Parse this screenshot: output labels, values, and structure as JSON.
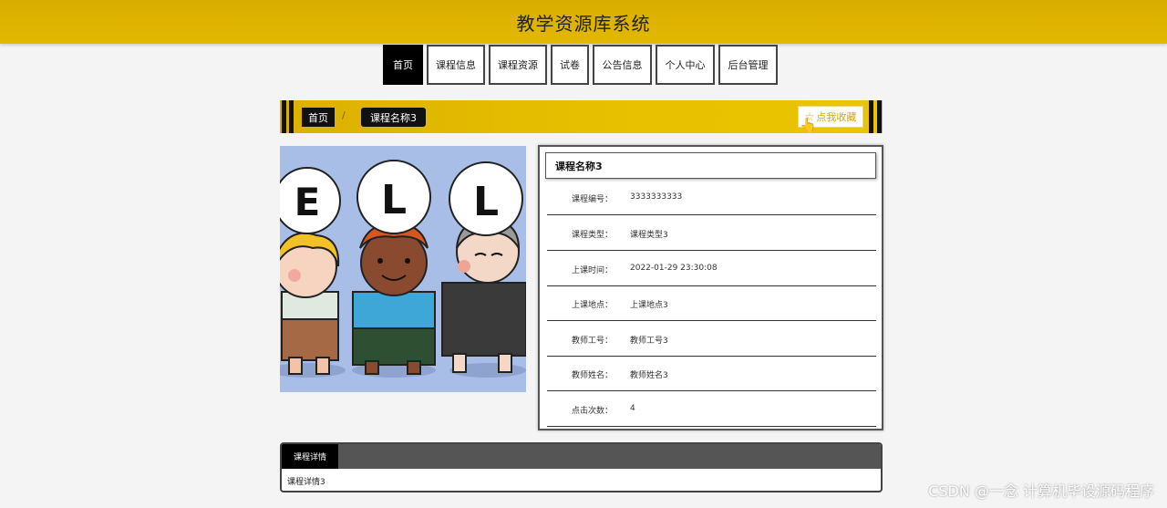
{
  "header": {
    "title": "教学资源库系统"
  },
  "nav": {
    "items": [
      {
        "label": "首页"
      },
      {
        "label": "课程信息"
      },
      {
        "label": "课程资源"
      },
      {
        "label": "试卷"
      },
      {
        "label": "公告信息"
      },
      {
        "label": "个人中心"
      },
      {
        "label": "后台管理"
      }
    ],
    "active_index": 0
  },
  "breadcrumb": {
    "home": "首页",
    "separator": "/",
    "current": "课程名称3",
    "favorite_label": "点我收藏"
  },
  "course": {
    "name": "课程名称3",
    "fields": [
      {
        "label": "课程编号：",
        "value": "3333333333"
      },
      {
        "label": "课程类型：",
        "value": "课程类型3"
      },
      {
        "label": "上课时间：",
        "value": "2022-01-29 23:30:08"
      },
      {
        "label": "上课地点：",
        "value": "上课地点3"
      },
      {
        "label": "教师工号：",
        "value": "教师工号3"
      },
      {
        "label": "教师姓名：",
        "value": "教师姓名3"
      },
      {
        "label": "点击次数：",
        "value": "4"
      }
    ]
  },
  "detail": {
    "tab_label": "课程详情",
    "content": "课程详情3"
  },
  "image": {
    "letters": [
      "E",
      "L",
      "L"
    ]
  },
  "watermark": "CSDN @一念 计算机毕设源码程序",
  "colors": {
    "accent": "#e3b800",
    "dark": "#111111"
  }
}
